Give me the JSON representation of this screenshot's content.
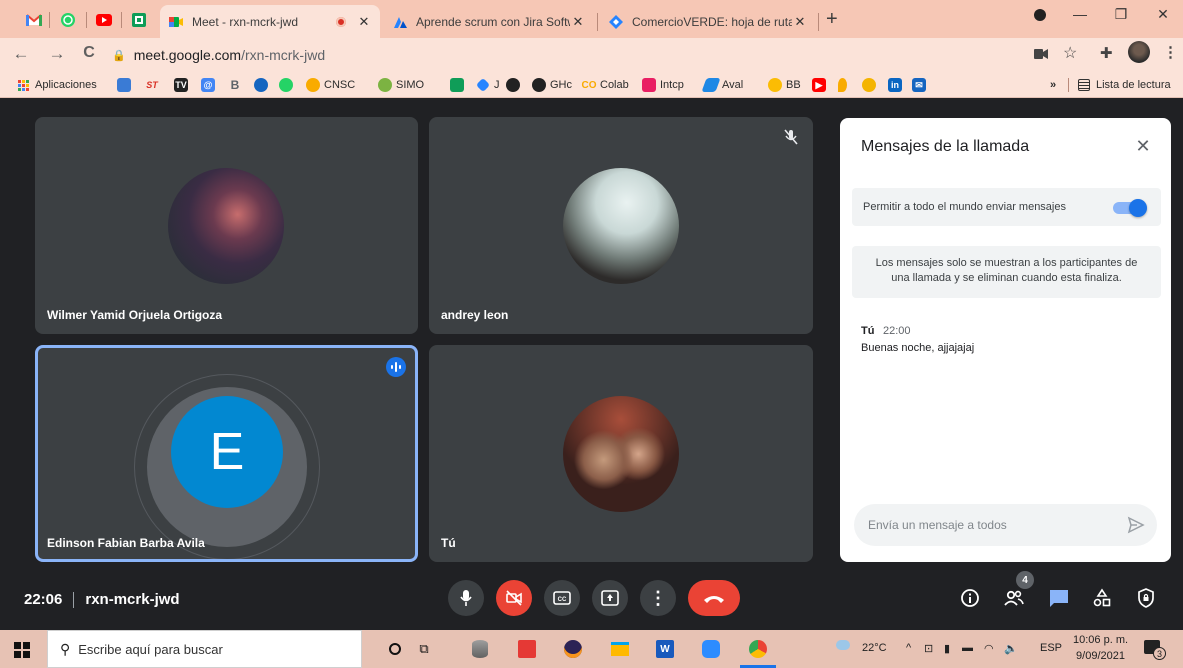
{
  "browser": {
    "pinned_tabs": [
      "gmail-icon",
      "whatsapp-icon",
      "youtube-icon",
      "classroom-icon"
    ],
    "tabs": [
      {
        "title": "Meet - rxn-mcrk-jwd",
        "active": true
      },
      {
        "title": "Aprende scrum con Jira Software",
        "active": false
      },
      {
        "title": "ComercioVERDE: hoja de ruta - Ji",
        "active": false
      }
    ],
    "new_tab": "+",
    "controls": {
      "minimize": "—",
      "restore": "❐",
      "close": "✕"
    },
    "url_host": "meet.google.com",
    "url_path": "/rxn-mcrk-jwd",
    "bookmarks": [
      {
        "label": "Aplicaciones",
        "icon": "apps-grid-icon",
        "color": "#1a73e8"
      },
      {
        "label": "",
        "icon": "bird-icon",
        "color": "#3a7bd5"
      },
      {
        "label": "",
        "icon": "st-icon",
        "color": "#d93025"
      },
      {
        "label": "",
        "icon": "tv-icon",
        "color": "#222222"
      },
      {
        "label": "",
        "icon": "at-icon",
        "color": "#4285f4"
      },
      {
        "label": "",
        "icon": "b-icon",
        "color": "#5f6368"
      },
      {
        "label": "",
        "icon": "anaconda-icon",
        "color": "#1565c0"
      },
      {
        "label": "",
        "icon": "whatsapp-icon",
        "color": "#25d366"
      },
      {
        "label": "CNSC",
        "icon": "cnsc-icon",
        "color": "#f9ab00"
      },
      {
        "label": "SIMO",
        "icon": "simo-icon",
        "color": "#7cb342"
      },
      {
        "label": "",
        "icon": "classroom-icon",
        "color": "#0f9d58"
      },
      {
        "label": "J",
        "icon": "jira-icon",
        "color": "#2684ff"
      },
      {
        "label": "",
        "icon": "github-icon",
        "color": "#222222"
      },
      {
        "label": "GHc",
        "icon": "github-icon",
        "color": "#222222"
      },
      {
        "label": "Colab",
        "icon": "colab-icon",
        "color": "#f9ab00"
      },
      {
        "label": "Intcp",
        "icon": "intcp-icon",
        "color": "#e91e63"
      },
      {
        "label": "Aval",
        "icon": "aval-icon",
        "color": "#1e88e5"
      },
      {
        "label": "BB",
        "icon": "bb-icon",
        "color": "#fbbc04"
      },
      {
        "label": "",
        "icon": "youtube-icon",
        "color": "#ff0000"
      },
      {
        "label": "",
        "icon": "drop-icon",
        "color": "#f9ab00"
      },
      {
        "label": "",
        "icon": "face-icon",
        "color": "#c58af9"
      },
      {
        "label": "",
        "icon": "linkedin-icon",
        "color": "#0a66c2"
      },
      {
        "label": "",
        "icon": "mail-icon",
        "color": "#1565c0"
      }
    ],
    "more_bookmarks": "»",
    "reading_list": "Lista de lectura"
  },
  "meet": {
    "participants": [
      {
        "name": "Wilmer Yamid Orjuela Ortigoza",
        "photo": "galaxy"
      },
      {
        "name": "andrey leon",
        "photo": "selfie",
        "muted": true
      },
      {
        "name": "Edinson Fabian Barba Avila",
        "initial": "E",
        "speaking": true,
        "avatar_color": "#0288d1"
      },
      {
        "name": "Tú",
        "photo": "couple"
      }
    ],
    "time": "22:06",
    "meeting_code": "rxn-mcrk-jwd",
    "participant_count": "4",
    "accent_red": "#ea4335",
    "accent_blue": "#1a73e8"
  },
  "chat": {
    "title": "Mensajes de la llamada",
    "allow_label": "Permitir a todo el mundo enviar mensajes",
    "allow_enabled": true,
    "info": "Los mensajes solo se muestran a los participantes de una llamada y se eliminan cuando esta finaliza.",
    "messages": [
      {
        "author": "Tú",
        "time": "22:00",
        "text": "Buenas noche, ajjajajaj"
      }
    ],
    "placeholder": "Envía un mensaje a todos"
  },
  "taskbar": {
    "search_placeholder": "Escribe aquí para buscar",
    "weather": "22°C",
    "language": "ESP",
    "clock_time": "10:06 p. m.",
    "clock_date": "9/09/2021",
    "notifications": "3"
  }
}
